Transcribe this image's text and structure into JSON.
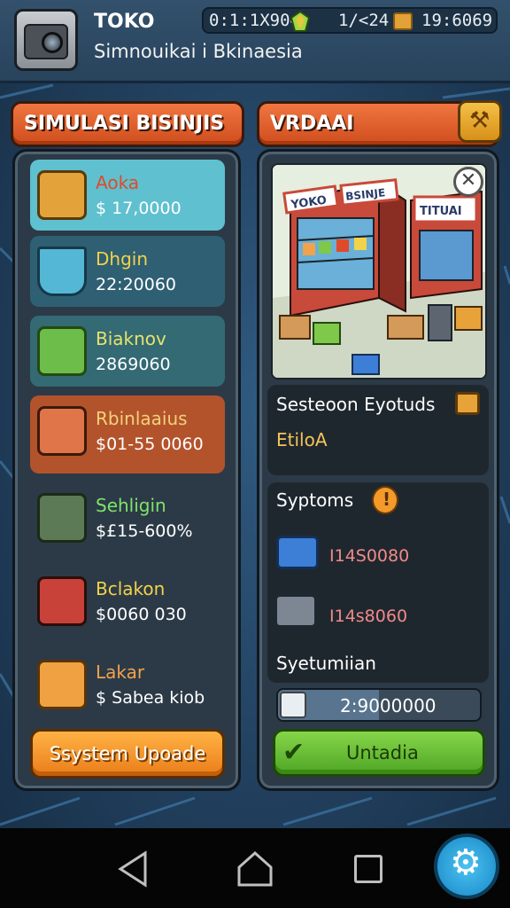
{
  "header": {
    "title": "TOKO",
    "subtitle": "Simnouikai i Bkinaesia",
    "resources": {
      "coins": "0:1:1X904",
      "time": "1/<24",
      "money": "19:6069"
    }
  },
  "left_panel": {
    "title": "SIMULASI BISINJIS",
    "items": [
      {
        "name": "Aoka",
        "price": "$ 17,0000",
        "name_color": "#e04a2a"
      },
      {
        "name": "Dhgin",
        "price": "22:20060",
        "name_color": "#f2d24a"
      },
      {
        "name": "Biaknov",
        "price": "2869060",
        "name_color": "#e8e36a"
      },
      {
        "name": "Rbinlaaius",
        "price": "$01-55 0060",
        "name_color": "#f2d27a"
      },
      {
        "name": "Sehligin",
        "price": "$£15-600%",
        "name_color": "#7fe36a"
      },
      {
        "name": "Bclakon",
        "price": "$0060 030",
        "name_color": "#f2d24a"
      },
      {
        "name": "Lakar",
        "price": "$ Sabea kiob",
        "name_color": "#f2a24a"
      }
    ],
    "upgrade_button": "Ssystem Upoade"
  },
  "right_panel": {
    "title": "VRDAAI",
    "scene_signs": {
      "left": "YOKO",
      "middle": "BSINJE",
      "right": "TITUAI"
    },
    "info": {
      "title": "Sesteoon Eyotuds",
      "value": "EtiloA"
    },
    "systems": {
      "title": "Syptoms",
      "rows": [
        {
          "value": "I14S0080"
        },
        {
          "value": "I14s8060"
        }
      ],
      "footer": "Syetumiian"
    },
    "progress": {
      "text": "2:9000000",
      "fill": 0.5
    },
    "confirm_button": "Untadia"
  },
  "colors": {
    "accent_orange": "#e2612a",
    "accent_green": "#5cb82c",
    "panel_bg": "#2c3a47"
  }
}
